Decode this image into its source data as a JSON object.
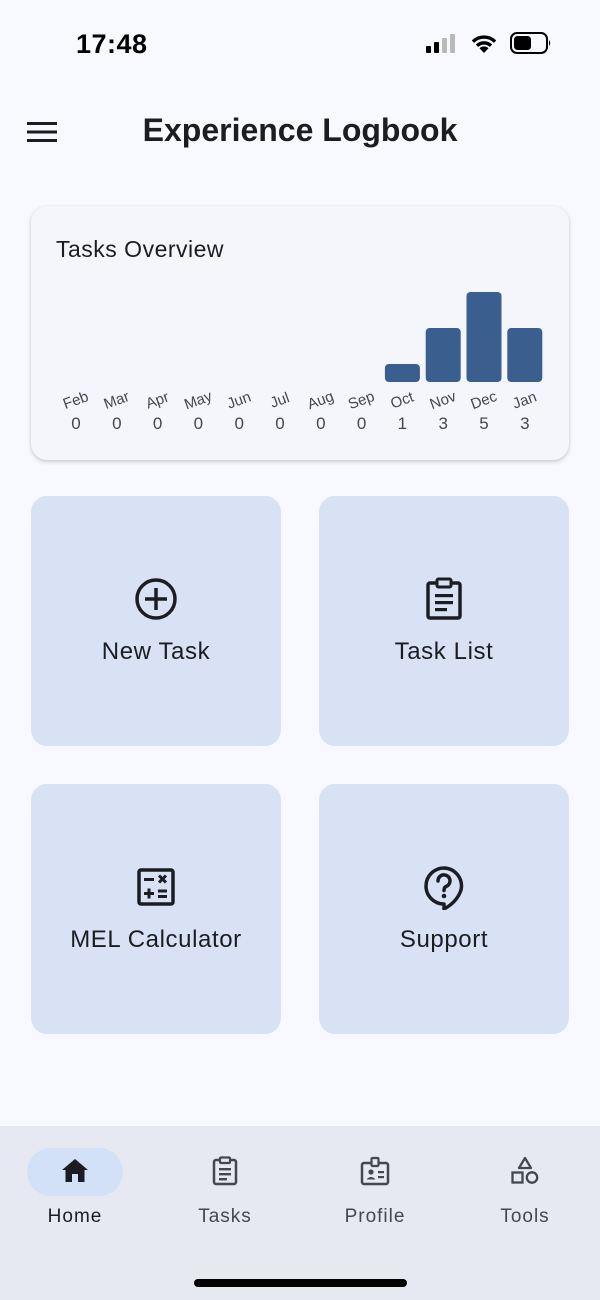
{
  "status_bar": {
    "time": "17:48"
  },
  "app_bar": {
    "title": "Experience Logbook"
  },
  "chart_data": {
    "type": "bar",
    "title": "Tasks Overview",
    "categories": [
      "Feb",
      "Mar",
      "Apr",
      "May",
      "Jun",
      "Jul",
      "Aug",
      "Sep",
      "Oct",
      "Nov",
      "Dec",
      "Jan"
    ],
    "values": [
      0,
      0,
      0,
      0,
      0,
      0,
      0,
      0,
      1,
      3,
      5,
      3
    ],
    "ylim": [
      0,
      5
    ],
    "grid": false,
    "bar_color": "#3a5f8f"
  },
  "tiles": [
    {
      "label": "New Task",
      "icon": "add-circle-icon"
    },
    {
      "label": "Task List",
      "icon": "clipboard-list-icon"
    },
    {
      "label": "MEL Calculator",
      "icon": "calculator-icon"
    },
    {
      "label": "Support",
      "icon": "help-bubble-icon"
    }
  ],
  "bottom_nav": {
    "items": [
      {
        "label": "Home",
        "icon": "home-icon",
        "active": true
      },
      {
        "label": "Tasks",
        "icon": "clipboard-icon",
        "active": false
      },
      {
        "label": "Profile",
        "icon": "id-badge-icon",
        "active": false
      },
      {
        "label": "Tools",
        "icon": "shapes-icon",
        "active": false
      }
    ]
  },
  "colors": {
    "background": "#f8f9ff",
    "tile": "#d8e2f4",
    "accent": "#3a5f8f",
    "nav_active_pill": "#d3e1f8"
  }
}
